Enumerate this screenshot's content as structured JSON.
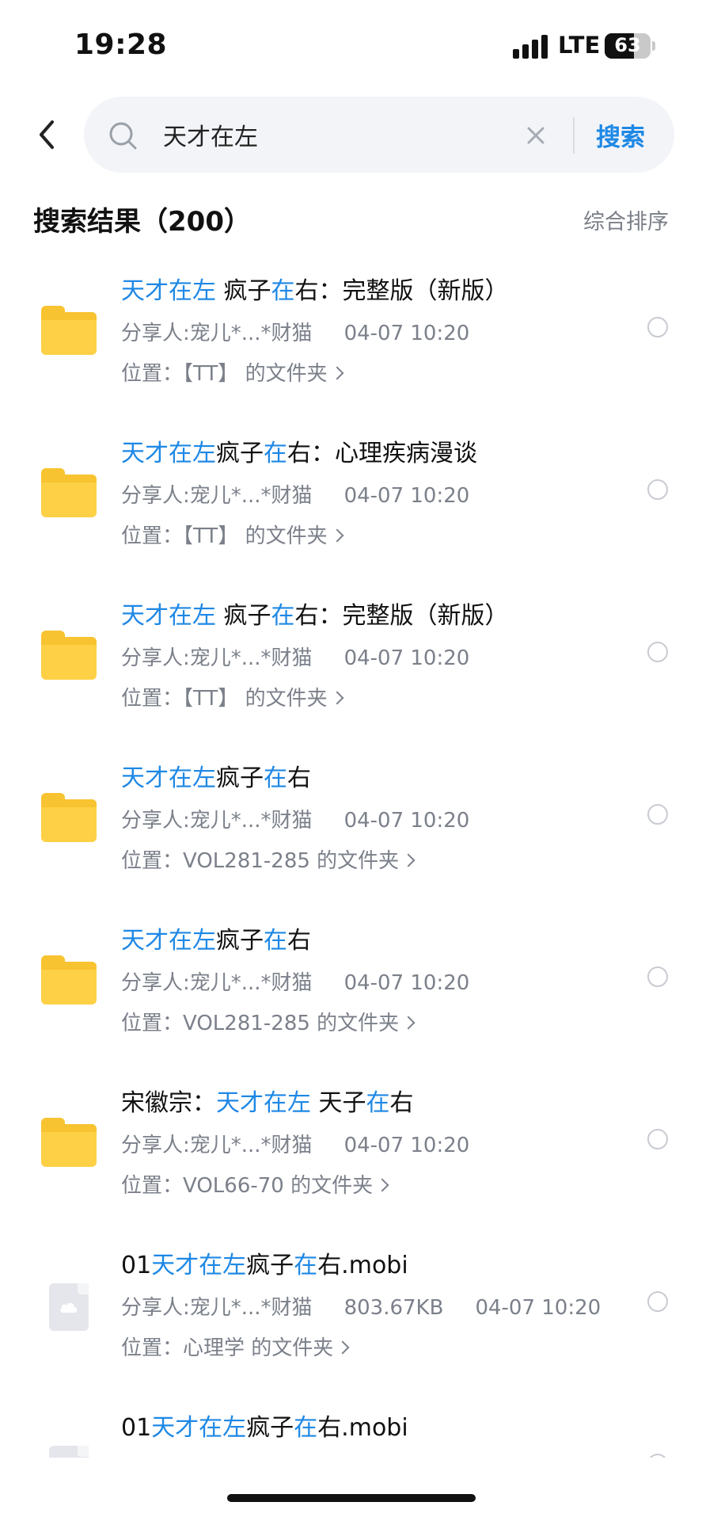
{
  "status": {
    "time": "19:28",
    "network": "LTE",
    "battery": "63",
    "battery_level": 0.63
  },
  "search": {
    "query": "天才在左",
    "button": "搜索"
  },
  "results": {
    "title": "搜索结果（200）",
    "sort": "综合排序"
  },
  "items": [
    {
      "type": "folder",
      "name": [
        {
          "t": "天才在左",
          "hl": true
        },
        {
          "t": " 疯子",
          "hl": false
        },
        {
          "t": "在",
          "hl": true
        },
        {
          "t": "右：完整版（新版）",
          "hl": false
        }
      ],
      "sharer": "分享人:宠儿*...*财猫",
      "size": "",
      "date": "04-07 10:20",
      "location": "位置：【TT】 的文件夹"
    },
    {
      "type": "folder",
      "name": [
        {
          "t": "天才在左",
          "hl": true
        },
        {
          "t": "疯子",
          "hl": false
        },
        {
          "t": "在",
          "hl": true
        },
        {
          "t": "右：心理疾病漫谈",
          "hl": false
        }
      ],
      "sharer": "分享人:宠儿*...*财猫",
      "size": "",
      "date": "04-07 10:20",
      "location": "位置：【TT】 的文件夹"
    },
    {
      "type": "folder",
      "name": [
        {
          "t": "天才在左",
          "hl": true
        },
        {
          "t": " 疯子",
          "hl": false
        },
        {
          "t": "在",
          "hl": true
        },
        {
          "t": "右：完整版（新版）",
          "hl": false
        }
      ],
      "sharer": "分享人:宠儿*...*财猫",
      "size": "",
      "date": "04-07 10:20",
      "location": "位置：【TT】 的文件夹"
    },
    {
      "type": "folder",
      "name": [
        {
          "t": "天才在左",
          "hl": true
        },
        {
          "t": "疯子",
          "hl": false
        },
        {
          "t": "在",
          "hl": true
        },
        {
          "t": "右",
          "hl": false
        }
      ],
      "sharer": "分享人:宠儿*...*财猫",
      "size": "",
      "date": "04-07 10:20",
      "location": "位置：VOL281-285 的文件夹"
    },
    {
      "type": "folder",
      "name": [
        {
          "t": "天才在左",
          "hl": true
        },
        {
          "t": "疯子",
          "hl": false
        },
        {
          "t": "在",
          "hl": true
        },
        {
          "t": "右",
          "hl": false
        }
      ],
      "sharer": "分享人:宠儿*...*财猫",
      "size": "",
      "date": "04-07 10:20",
      "location": "位置：VOL281-285 的文件夹"
    },
    {
      "type": "folder",
      "name": [
        {
          "t": "宋徽宗：",
          "hl": false
        },
        {
          "t": "天才在左",
          "hl": true
        },
        {
          "t": " 天子",
          "hl": false
        },
        {
          "t": "在",
          "hl": true
        },
        {
          "t": "右",
          "hl": false
        }
      ],
      "sharer": "分享人:宠儿*...*财猫",
      "size": "",
      "date": "04-07 10:20",
      "location": "位置：VOL66-70 的文件夹"
    },
    {
      "type": "file",
      "name": [
        {
          "t": "01",
          "hl": false
        },
        {
          "t": "天才在左",
          "hl": true
        },
        {
          "t": "疯子",
          "hl": false
        },
        {
          "t": "在",
          "hl": true
        },
        {
          "t": "右.mobi",
          "hl": false
        }
      ],
      "sharer": "分享人:宠儿*...*财猫",
      "size": "803.67KB",
      "date": "04-07 10:20",
      "location": "位置：心理学 的文件夹"
    },
    {
      "type": "file",
      "name": [
        {
          "t": "01",
          "hl": false
        },
        {
          "t": "天才在左",
          "hl": true
        },
        {
          "t": "疯子",
          "hl": false
        },
        {
          "t": "在",
          "hl": true
        },
        {
          "t": "右.mobi",
          "hl": false
        }
      ],
      "sharer": "分享人:宠儿*...*财猫",
      "size": "",
      "date": "",
      "location": ""
    }
  ],
  "colors": {
    "accent": "#1e88e5",
    "folder": "#fdd045",
    "muted": "#7b808a"
  }
}
